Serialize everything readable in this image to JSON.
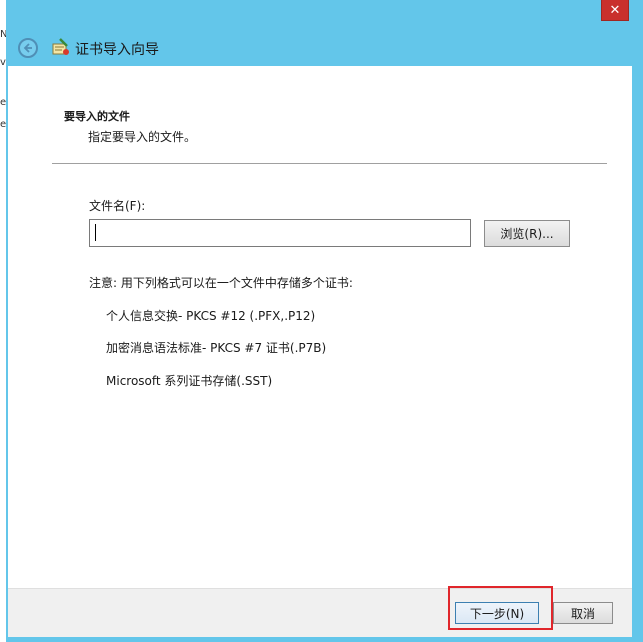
{
  "background": {
    "edge_chars": [
      "N",
      "v",
      "e",
      "e"
    ]
  },
  "window": {
    "close_label": "✕",
    "title": "证书导入向导",
    "back_icon": "back-arrow-icon",
    "wizard_icon": "certificate-wizard-icon"
  },
  "content": {
    "section_header": "要导入的文件",
    "section_sub": "指定要导入的文件。",
    "file_label": "文件名(F):",
    "file_value": "",
    "browse_label": "浏览(R)...",
    "note": "注意: 用下列格式可以在一个文件中存储多个证书:",
    "formats": [
      "个人信息交换- PKCS #12 (.PFX,.P12)",
      "加密消息语法标准- PKCS #7 证书(.P7B)",
      "Microsoft 系列证书存储(.SST)"
    ]
  },
  "footer": {
    "next_label": "下一步(N)",
    "cancel_label": "取消"
  },
  "colors": {
    "title_bar": "#63c6ea",
    "close_button": "#c9302c",
    "highlight": "#e0262b"
  }
}
